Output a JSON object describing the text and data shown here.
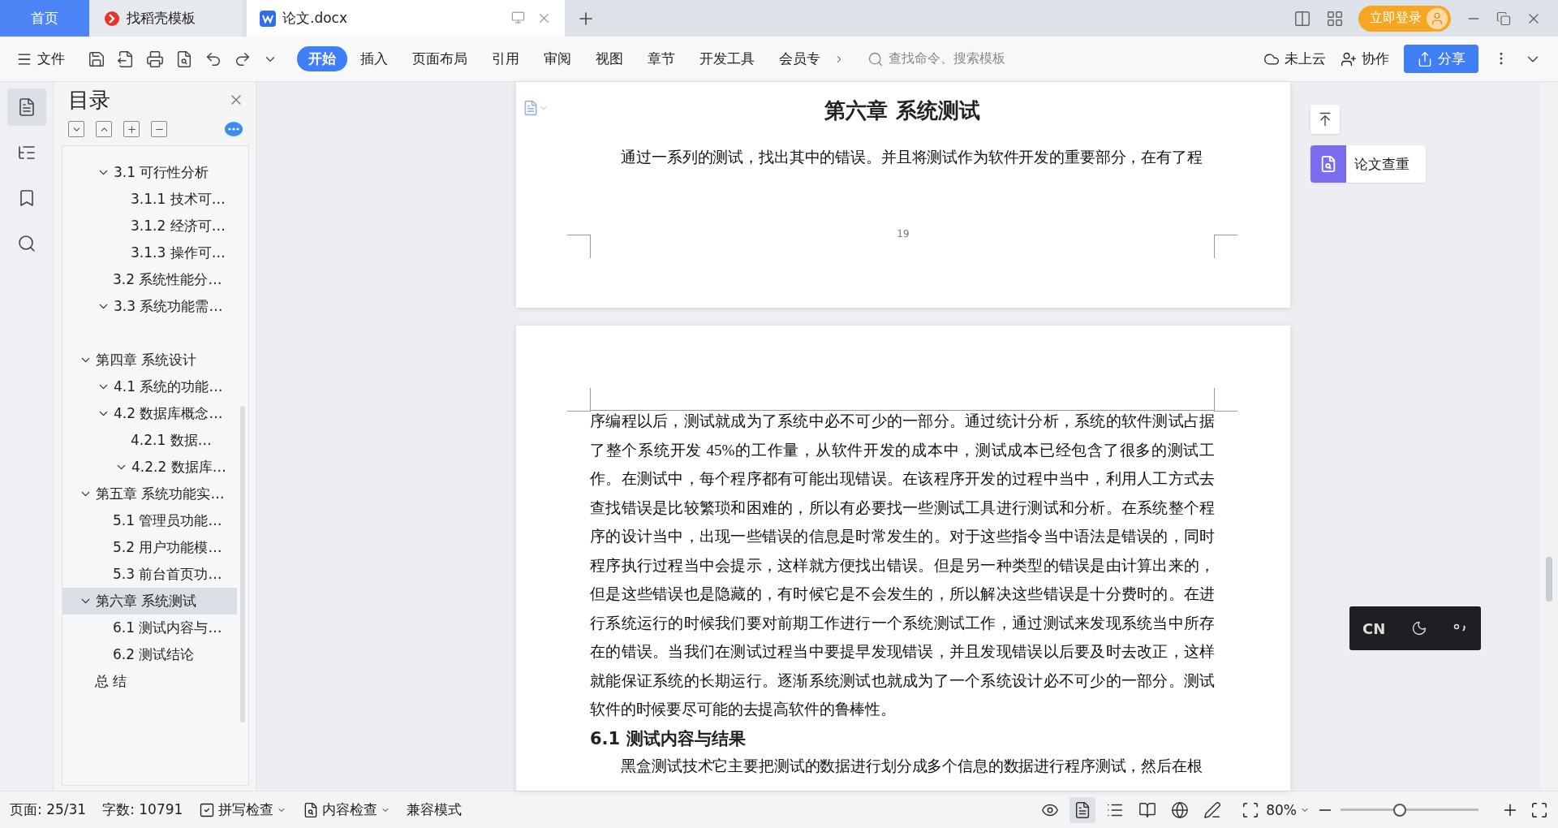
{
  "tabs": [
    {
      "label": "首页",
      "kind": "home",
      "selected": false
    },
    {
      "label": "找稻壳模板",
      "kind": "docer",
      "selected": false
    },
    {
      "label": "论文.docx",
      "kind": "document",
      "selected": true
    }
  ],
  "account": {
    "login": "立即登录"
  },
  "toolbar": {
    "file_menu": "文件",
    "ribbon_tabs": [
      {
        "label": "开始",
        "selected": true
      },
      {
        "label": "插入",
        "selected": false
      },
      {
        "label": "页面布局",
        "selected": false
      },
      {
        "label": "引用",
        "selected": false
      },
      {
        "label": "审阅",
        "selected": false
      },
      {
        "label": "视图",
        "selected": false
      },
      {
        "label": "章节",
        "selected": false
      },
      {
        "label": "开发工具",
        "selected": false
      },
      {
        "label": "会员专",
        "selected": false
      }
    ],
    "search": {
      "placeholder": "查找命令、搜索模板"
    },
    "cloud": "未上云",
    "collab": "协作",
    "share": "分享"
  },
  "rail": [
    {
      "kind": "toc",
      "selected": true
    },
    {
      "kind": "structure",
      "selected": false
    },
    {
      "kind": "bookmark",
      "selected": false
    },
    {
      "kind": "search",
      "selected": false
    }
  ],
  "toc": {
    "title": "目录",
    "partial_items": [
      {
        "label": "3.1  可行性分析",
        "expanded": true,
        "selected": false,
        "children": [
          {
            "label": "3.1.1   技术可…",
            "selected": false
          },
          {
            "label": "3.1.2  经济可…",
            "selected": false
          },
          {
            "label": "3.1.3  操作可…",
            "selected": false
          }
        ]
      },
      {
        "label": "3.2  系统性能分…",
        "selected": false
      },
      {
        "label": "3.3  系统功能需…",
        "expanded": true,
        "selected": false
      }
    ],
    "chapters": [
      {
        "label": "第四章  系统设计",
        "expanded": true,
        "selected": false,
        "children": [
          {
            "label": "4.1  系统的功能…",
            "expanded": true,
            "selected": false
          },
          {
            "label": "4.2  数据库概念…",
            "expanded": true,
            "selected": false,
            "children": [
              {
                "label": "4.2.1   数据…",
                "selected": false
              },
              {
                "label": "4.2.2  数据库…",
                "expanded": true,
                "selected": false
              }
            ]
          }
        ]
      },
      {
        "label": "第五章  系统功能实…",
        "expanded": true,
        "selected": false,
        "children": [
          {
            "label": "5.1 管理员功能…",
            "selected": false
          },
          {
            "label": "5.2 用户功能模…",
            "selected": false
          },
          {
            "label": "5.3 前台首页功…",
            "selected": false
          }
        ]
      },
      {
        "label": "第六章  系统测试",
        "expanded": true,
        "selected": true,
        "children": [
          {
            "label": "6.1  测试内容与…",
            "selected": false
          },
          {
            "label": "6.2  测试结论",
            "selected": false
          }
        ]
      },
      {
        "label": "总  结",
        "selected": false
      }
    ]
  },
  "document": {
    "pages": [
      {
        "blocks": [
          {
            "kind": "chapter_heading",
            "text": "第六章  系统测试"
          },
          {
            "kind": "paragraph",
            "text": "通过一系列的测试，找出其中的错误。并且将测试作为软件开发的重要部分，在有了程"
          }
        ],
        "page_number": "19"
      },
      {
        "blocks": [
          {
            "kind": "continuation",
            "text": "序编程以后，测试就成为了系统中必不可少的一部分。通过统计分析，系统的软件测试占据了整个系统开发 45%的工作量，从软件开发的成本中，测试成本已经包含了很多的测试工作。在测试中，每个程序都有可能出现错误。在该程序开发的过程中当中，利用人工方式去查找错误是比较繁琐和困难的，所以有必要找一些测试工具进行测试和分析。在系统整个程序的设计当中，出现一些错误的信息是时常发生的。对于这些指令当中语法是错误的，同时程序执行过程当中会提示，这样就方便找出错误。但是另一种类型的错误是由计算出来的，但是这些错误也是隐藏的，有时候它是不会发生的，所以解决这些错误是十分费时的。在进行系统运行的时候我们要对前期工作进行一个系统测试工作，通过测试来发现系统当中所存在的错误。当我们在测试过程当中要提早发现错误，并且发现错误以后要及时去改正，这样就能保证系统的长期运行。逐渐系统测试也就成为了一个系统设计必不可少的一部分。测试软件的时候要尽可能的去提高软件的鲁棒性。"
          },
          {
            "kind": "section_heading",
            "text": "6.1  测试内容与结果"
          },
          {
            "kind": "paragraph",
            "text": "黑盒测试技术它主要把测试的数据进行划分成多个信息的数据进行程序测试，然后在根"
          }
        ]
      }
    ]
  },
  "side_panel": {
    "check_button": "论文查重"
  },
  "ime": {
    "language": "CN"
  },
  "status_bar": {
    "page": "页面: 25/31",
    "words": "字数: 10791",
    "spell_check": "拼写检查",
    "content_check": "内容检查",
    "mode": "兼容模式",
    "view_tools": [
      {
        "kind": "eye",
        "selected": false
      },
      {
        "kind": "page",
        "selected": true
      },
      {
        "kind": "outline",
        "selected": false
      },
      {
        "kind": "book",
        "selected": false
      },
      {
        "kind": "web",
        "selected": false
      },
      {
        "kind": "pen",
        "selected": false
      }
    ],
    "zoom": "80%",
    "zoom_slider": {
      "level": 0.44
    }
  }
}
